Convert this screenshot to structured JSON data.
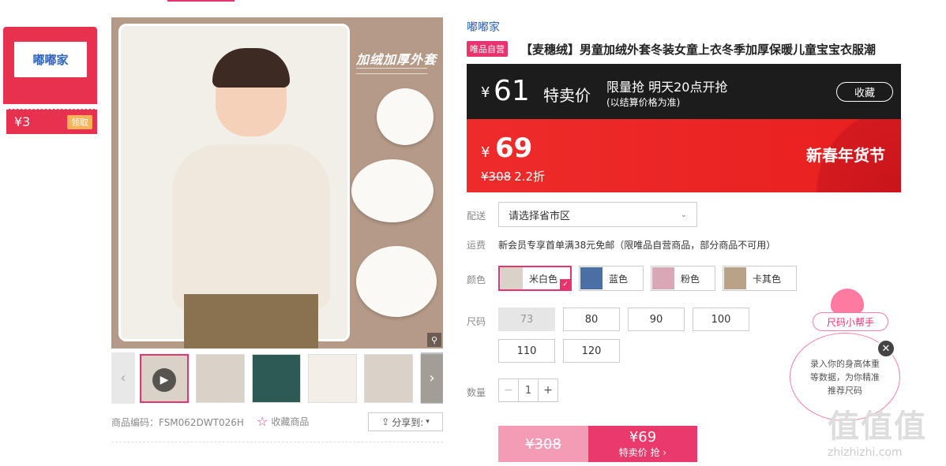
{
  "coupon": {
    "logo": "嘟嘟家",
    "amount": "¥3",
    "button": "领取"
  },
  "image": {
    "title": "加绒加厚外套"
  },
  "meta": {
    "code": "商品编码：FSM062DWT026H",
    "fav": "收藏商品",
    "share": "分享到:"
  },
  "product": {
    "brand": "嘟嘟家",
    "tag": "唯品自营",
    "title": "【麦穗绒】男童加绒外套冬装女童上衣冬季加厚保暖儿童宝宝衣服潮"
  },
  "flash": {
    "currency": "¥",
    "price": "61",
    "label": "特卖价",
    "line1": "限量抢 明天20点开抢",
    "line2": "(以结算价格为准)",
    "collect": "收藏"
  },
  "sale": {
    "currency": "¥",
    "price": "69",
    "orig": "¥308",
    "discount": "2.2折",
    "festival": "新春年货节"
  },
  "delivery": {
    "label": "配送",
    "placeholder": "请选择省市区"
  },
  "shipping": {
    "label": "运费",
    "text": "新会员专享首单满38元免邮（限唯品自营商品，部分商品不可用）"
  },
  "colors": {
    "label": "颜色",
    "items": [
      "米白色",
      "蓝色",
      "粉色",
      "卡其色"
    ]
  },
  "sizes": {
    "label": "尺码",
    "items": [
      "73",
      "80",
      "90",
      "100",
      "110",
      "120"
    ]
  },
  "quantity": {
    "label": "数量",
    "minus": "−",
    "value": "1",
    "plus": "+"
  },
  "buy": {
    "orig": "¥308",
    "price": "¥69",
    "sub": "特卖价 抢 ›"
  },
  "helper": {
    "button": "尺码小帮手",
    "text": "录入你的身高体重等数据，为你精准推荐尺码",
    "close": "✕"
  },
  "watermark": {
    "logo": "值值值",
    "url": "zhizhizhi.com"
  },
  "thumbs": {
    "prev": "‹",
    "next": "›",
    "play": "▶"
  }
}
